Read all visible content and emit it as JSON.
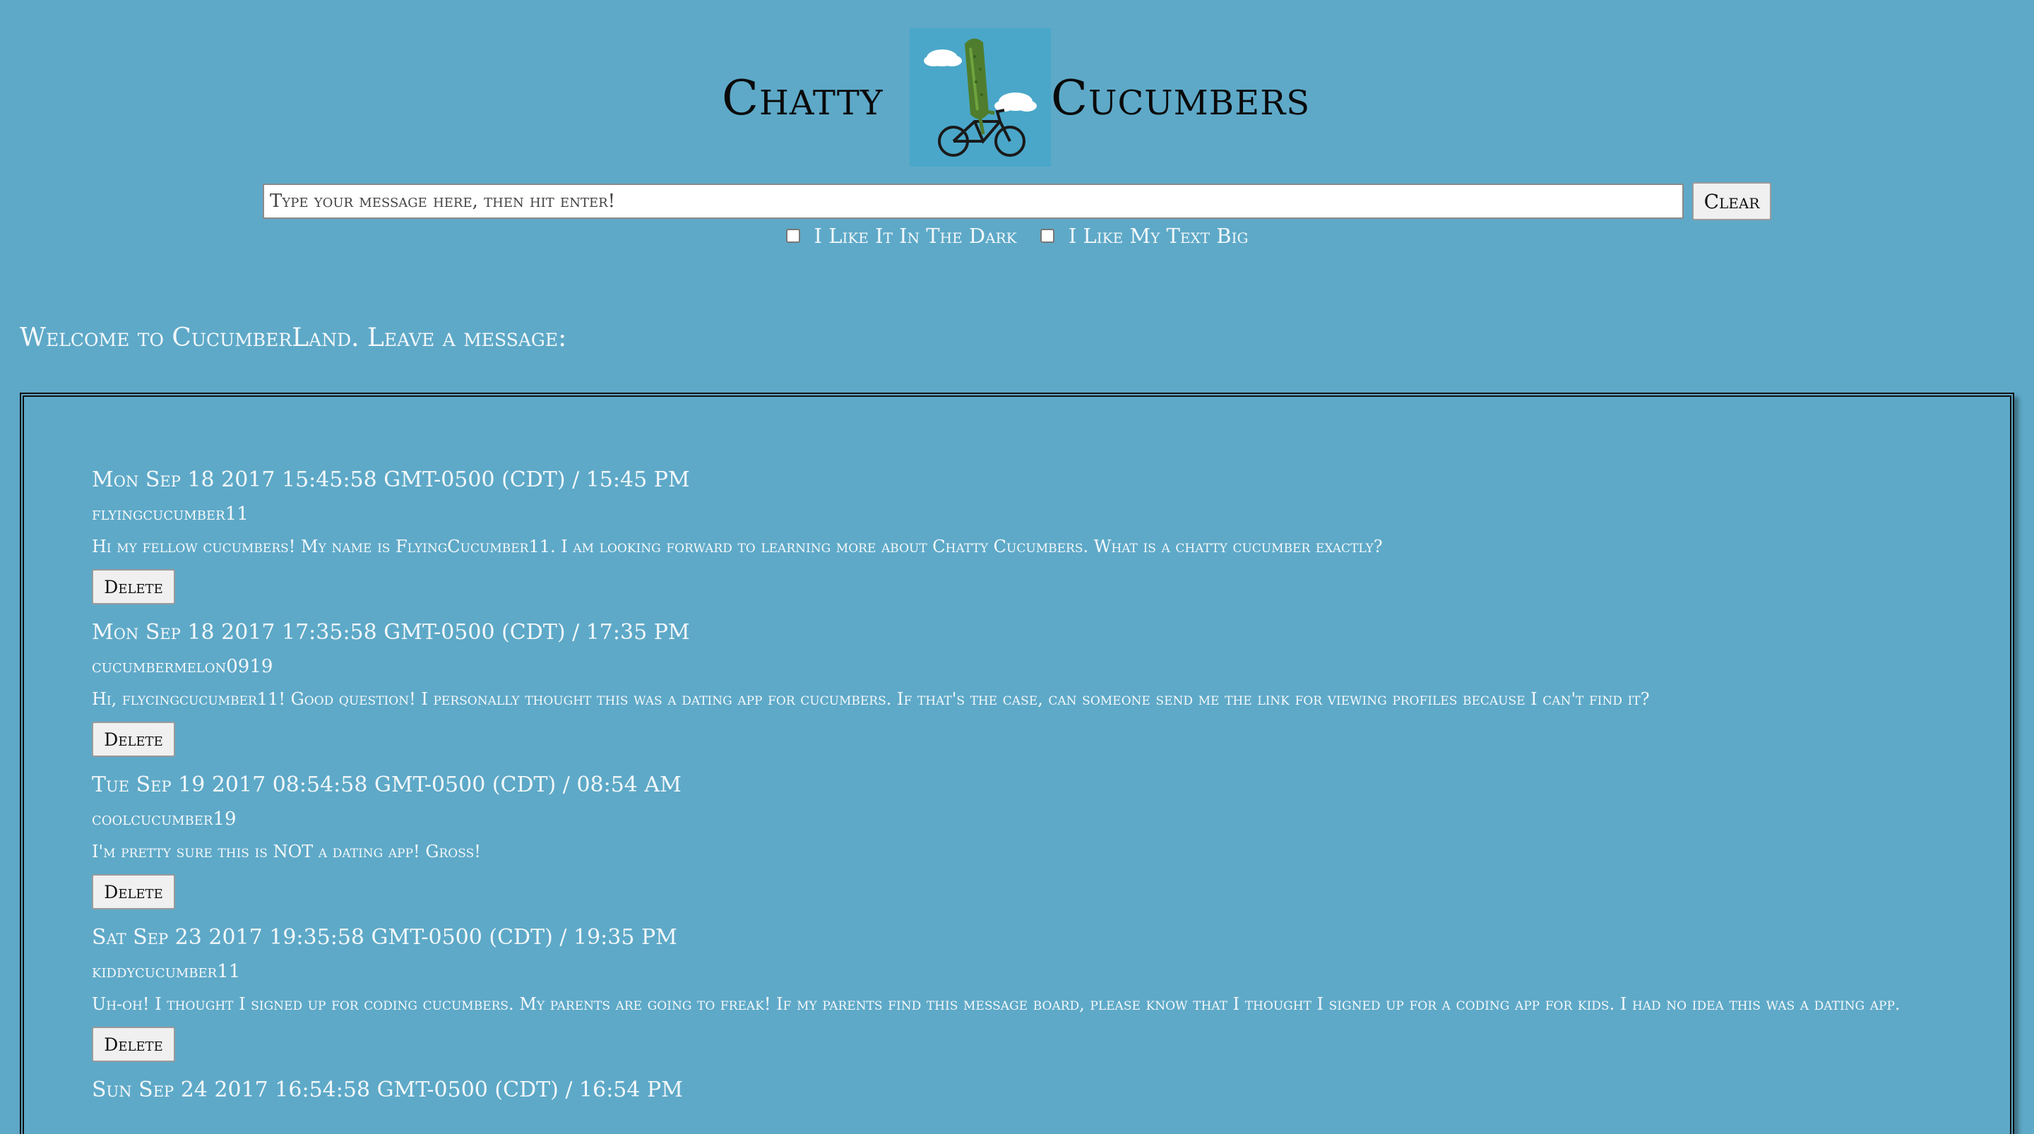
{
  "header": {
    "title_left": "Chatty",
    "title_right": "Cucumbers",
    "logo_icon": "cucumber-on-bicycle-logo"
  },
  "composer": {
    "placeholder": "Type your message here, then hit enter!",
    "clear_label": "Clear"
  },
  "options": {
    "dark_label": "I Like It In The Dark",
    "dark_checked": false,
    "big_text_label": "I Like My Text Big",
    "big_text_checked": false
  },
  "welcome": "Welcome to CucumberLand. Leave a message:",
  "board": {
    "delete_label": "Delete",
    "messages": [
      {
        "time": "Mon Sep 18 2017 15:45:58 GMT-0500 (CDT) / 15:45 PM",
        "user": "flyingcucumber11",
        "text": "Hi my fellow cucumbers! My name is FlyingCucumber11. I am looking forward to learning more about Chatty Cucumbers. What is a chatty cucumber exactly?"
      },
      {
        "time": "Mon Sep 18 2017 17:35:58 GMT-0500 (CDT) / 17:35 PM",
        "user": "cucumbermelon0919",
        "text": "Hi, flycingcucumber11! Good question! I personally thought this was a dating app for cucumbers. If that's the case, can someone send me the link for viewing profiles because I can't find it?"
      },
      {
        "time": "Tue Sep 19 2017 08:54:58 GMT-0500 (CDT) / 08:54 AM",
        "user": "coolcucumber19",
        "text": "I'm pretty sure this is NOT a dating app! Gross!"
      },
      {
        "time": "Sat Sep 23 2017 19:35:58 GMT-0500 (CDT) / 19:35 PM",
        "user": "kiddycucumber11",
        "text": "Uh-oh! I thought I signed up for coding cucumbers. My parents are going to freak! If my parents find this message board, please know that I thought I signed up for a coding app for kids. I had no idea this was a dating app."
      },
      {
        "time": "Sun Sep 24 2017 16:54:58 GMT-0500 (CDT) / 16:54 PM",
        "user": "",
        "text": ""
      }
    ]
  }
}
